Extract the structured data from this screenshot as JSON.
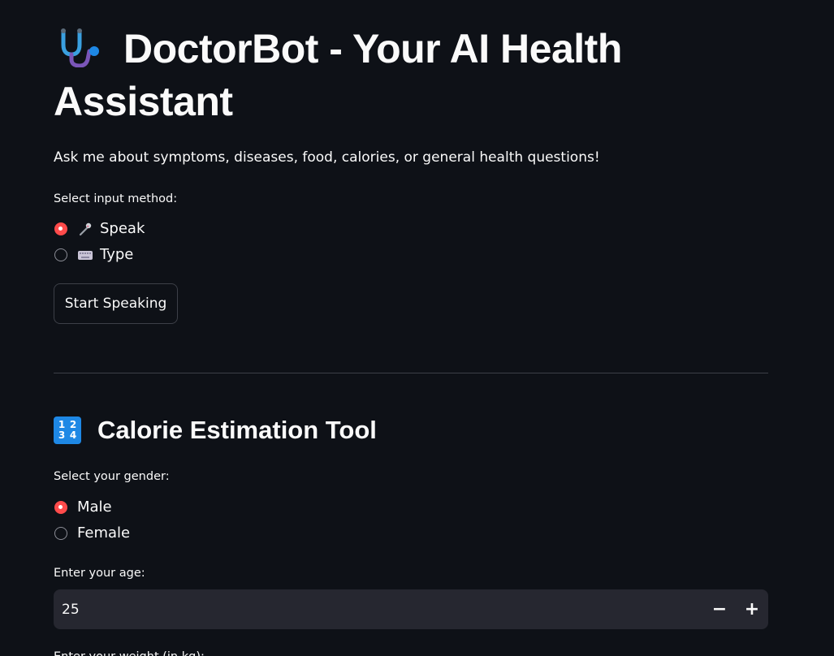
{
  "header": {
    "title": "DoctorBot - Your AI Health Assistant",
    "title_icon": "stethoscope-icon",
    "subtitle": "Ask me about symptoms, diseases, food, calories, or general health questions!"
  },
  "input_method": {
    "label": "Select input method:",
    "options": [
      {
        "label": "Speak",
        "icon": "microphone-icon",
        "selected": true
      },
      {
        "label": "Type",
        "icon": "keyboard-icon",
        "selected": false
      }
    ],
    "button_label": "Start Speaking"
  },
  "calorie_tool": {
    "title": "Calorie Estimation Tool",
    "title_icon": "numbers-1234-icon",
    "icon_digits": [
      "1",
      "2",
      "3",
      "4"
    ],
    "gender": {
      "label": "Select your gender:",
      "options": [
        {
          "label": "Male",
          "selected": true
        },
        {
          "label": "Female",
          "selected": false
        }
      ]
    },
    "age": {
      "label": "Enter your age:",
      "value": "25",
      "decrement": "−",
      "increment": "+"
    },
    "next_label": "Enter your weight (in kg):"
  },
  "colors": {
    "background": "#0e1117",
    "accent": "#ff4b4b",
    "input_bg": "#262730",
    "text": "#fafafa"
  }
}
